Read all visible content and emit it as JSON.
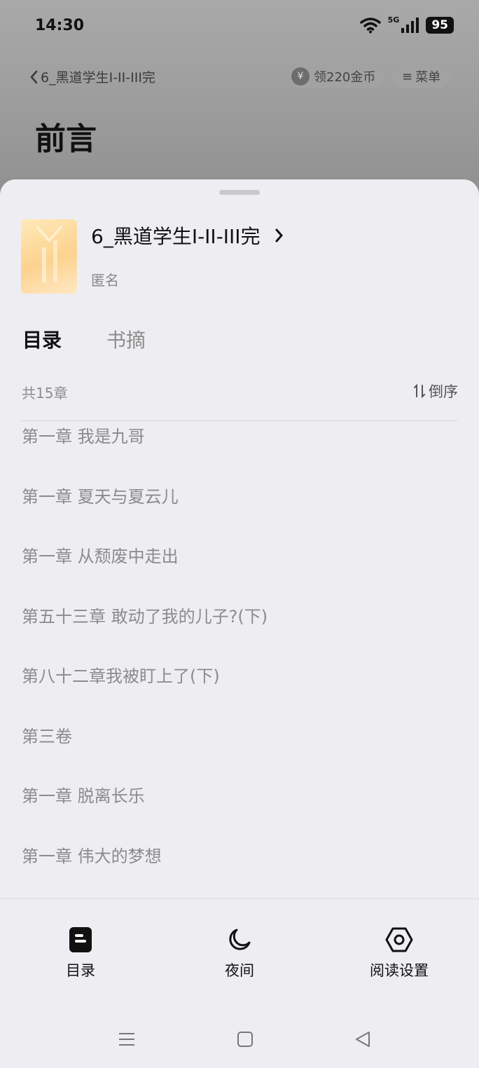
{
  "status_bar": {
    "time": "14:30",
    "network": "5G",
    "battery": "95"
  },
  "topbar": {
    "back_label": "6_黑道学生I-II-III完",
    "coin_label": "领220金币",
    "coin_symbol": "¥",
    "menu_label": "菜单"
  },
  "page": {
    "title": "前言"
  },
  "book": {
    "title": "6_黑道学生I-II-III完",
    "author": "匿名"
  },
  "tabs": [
    {
      "label": "目录",
      "active": true
    },
    {
      "label": "书摘",
      "active": false
    }
  ],
  "toc": {
    "count_label": "共15章",
    "sort_label": "倒序",
    "chapters": [
      "第一章 我是九哥",
      "第一章 夏天与夏云儿",
      "第一章 从颓废中走出",
      "第五十三章 敢动了我的儿子?(下)",
      "第八十二章我被盯上了(下)",
      "第三卷",
      "第一章 脱离长乐",
      "第一章 伟大的梦想"
    ]
  },
  "bottom_nav": [
    {
      "label": "目录",
      "icon": "toc-icon"
    },
    {
      "label": "夜间",
      "icon": "moon-icon"
    },
    {
      "label": "阅读设置",
      "icon": "settings-icon"
    }
  ],
  "system_nav": [
    "menu-icon",
    "home-icon",
    "back-icon"
  ],
  "colors": {
    "sheet_bg": "#eeeef2",
    "text_primary": "#111111",
    "text_muted": "#8b8b8b"
  }
}
